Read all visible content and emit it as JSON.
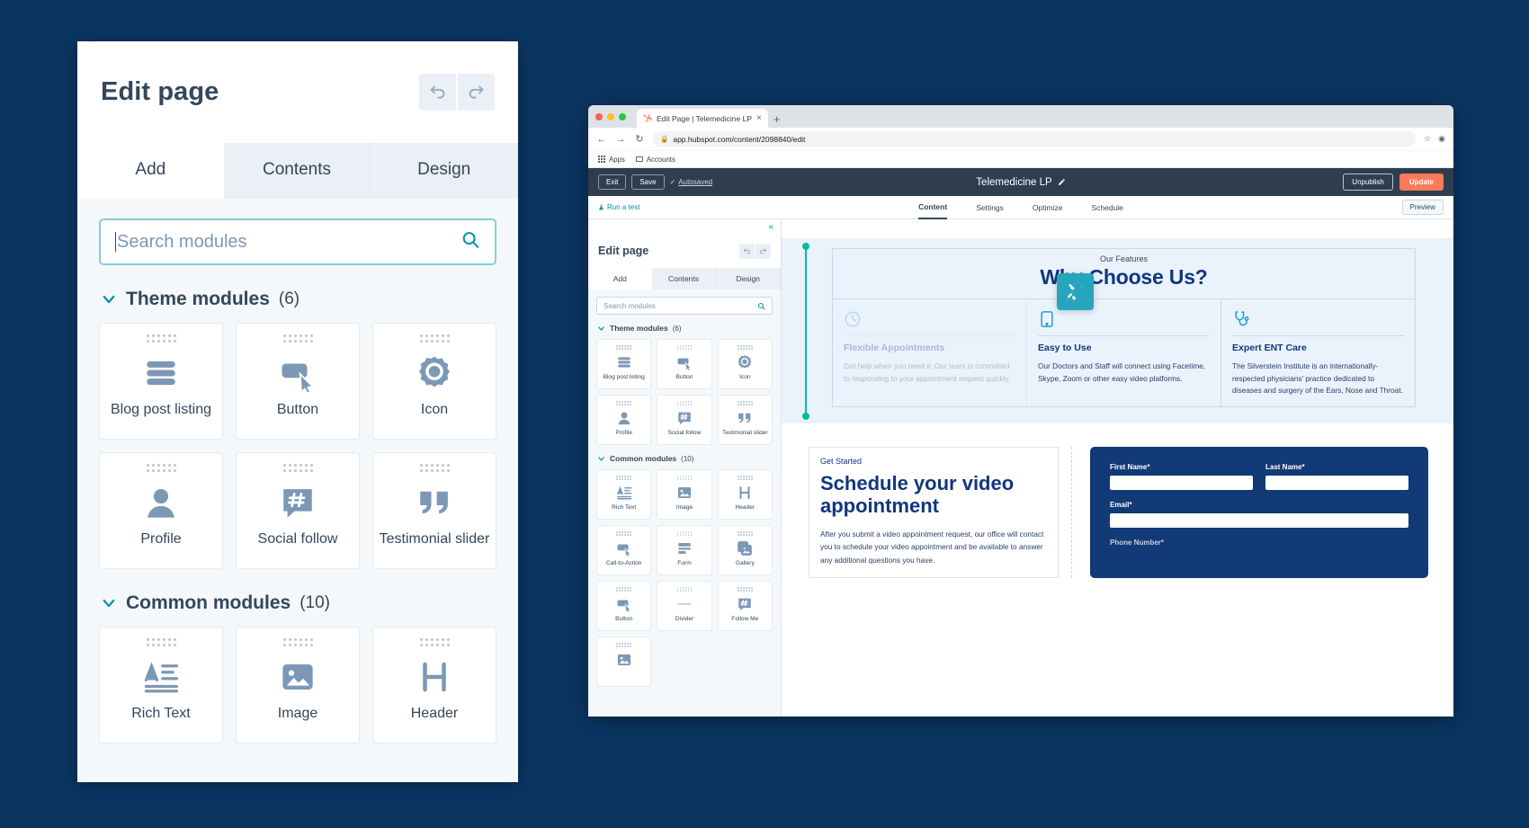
{
  "page": {
    "bg_color": "#0b3461"
  },
  "editor_panel": {
    "title": "Edit page",
    "undo_label": "Undo",
    "redo_label": "Redo",
    "tabs": [
      {
        "label": "Add",
        "active": true
      },
      {
        "label": "Contents",
        "active": false
      },
      {
        "label": "Design",
        "active": false
      }
    ],
    "search": {
      "placeholder": "Search modules",
      "value": "",
      "icon": "search-icon"
    },
    "groups": [
      {
        "name": "Theme modules",
        "count": "(6)",
        "modules": [
          {
            "label": "Blog post listing",
            "icon": "list-lines-icon"
          },
          {
            "label": "Button",
            "icon": "button-cursor-icon"
          },
          {
            "label": "Icon",
            "icon": "badge-circle-icon"
          },
          {
            "label": "Profile",
            "icon": "person-icon"
          },
          {
            "label": "Social follow",
            "icon": "hashtag-bubble-icon"
          },
          {
            "label": "Testimonial slider",
            "icon": "quote-marks-icon"
          }
        ]
      },
      {
        "name": "Common modules",
        "count": "(10)",
        "modules": [
          {
            "label": "Rich Text",
            "icon": "rich-text-icon"
          },
          {
            "label": "Image",
            "icon": "image-icon"
          },
          {
            "label": "Header",
            "icon": "heading-h-icon"
          }
        ]
      }
    ]
  },
  "browser": {
    "tab": {
      "title": "Edit Page | Telemedicine LP",
      "close_label": "×",
      "favicon": "hubspot-sprocket-icon"
    },
    "new_tab_label": "+",
    "nav": {
      "back": "←",
      "forward": "→",
      "reload": "↻"
    },
    "url": "app.hubspot.com/content/2098840/edit",
    "lock_icon": "lock-icon",
    "star_icon": "star-icon",
    "profile_icon": "account-circle-icon",
    "bookmarks": [
      {
        "label": "Apps",
        "icon": "apps-grid-icon"
      },
      {
        "label": "Accounts",
        "icon": "folder-icon"
      }
    ]
  },
  "hubspot": {
    "toolbar": {
      "exit_label": "Exit",
      "save_label": "Save",
      "autosaved_label": "Autosaved",
      "autosaved_check": "✓",
      "doc_title": "Telemedicine LP",
      "edit_icon": "pencil-icon",
      "unpublish_label": "Unpublish",
      "update_label": "Update",
      "update_color": "#ff7a59"
    },
    "navbar": {
      "run_test_label": "Run a test",
      "run_test_icon": "flask-icon",
      "tabs": [
        {
          "label": "Content",
          "active": true
        },
        {
          "label": "Settings",
          "active": false
        },
        {
          "label": "Optimize",
          "active": false
        },
        {
          "label": "Schedule",
          "active": false
        }
      ],
      "preview_label": "Preview"
    },
    "inner_editor": {
      "collapse_icon": "double-chevron-left-icon",
      "title": "Edit page",
      "tabs": [
        {
          "label": "Add",
          "active": true
        },
        {
          "label": "Contents",
          "active": false
        },
        {
          "label": "Design",
          "active": false
        }
      ],
      "search": {
        "placeholder": "Search modules",
        "value": "",
        "icon": "search-icon"
      },
      "groups": [
        {
          "name": "Theme modules",
          "count": "(6)",
          "modules": [
            {
              "label": "Blog post listing",
              "icon": "list-lines-icon"
            },
            {
              "label": "Button",
              "icon": "button-cursor-icon"
            },
            {
              "label": "Icon",
              "icon": "badge-circle-icon"
            },
            {
              "label": "Profile",
              "icon": "person-icon"
            },
            {
              "label": "Social follow",
              "icon": "hashtag-bubble-icon"
            },
            {
              "label": "Testimonial slider",
              "icon": "quote-marks-icon"
            }
          ]
        },
        {
          "name": "Common modules",
          "count": "(10)",
          "modules": [
            {
              "label": "Rich Text",
              "icon": "rich-text-icon"
            },
            {
              "label": "Image",
              "icon": "image-icon"
            },
            {
              "label": "Header",
              "icon": "heading-h-icon"
            },
            {
              "label": "Call-to-Action",
              "icon": "button-cursor-icon"
            },
            {
              "label": "Form",
              "icon": "form-rows-icon"
            },
            {
              "label": "Gallery",
              "icon": "gallery-icon"
            },
            {
              "label": "Button",
              "icon": "button-cursor-icon"
            },
            {
              "label": "Divider",
              "icon": "divider-line-icon"
            },
            {
              "label": "Follow Me",
              "icon": "hashtag-bubble-icon"
            },
            {
              "label": "",
              "icon": "image-icon"
            }
          ]
        }
      ]
    },
    "preview": {
      "drag_chip_icon": "tools-cross-icon",
      "drag_chip_color": "#27a5bd",
      "features": {
        "eyebrow": "Our Features",
        "heading": "Why Choose Us?",
        "columns": [
          {
            "icon": "clock-icon",
            "title": "Flexible Appointments",
            "body": "Get help when you need it. Our team is committed to responding to your appointment request quickly.",
            "dimmed": true
          },
          {
            "icon": "tablet-icon",
            "title": "Easy to Use",
            "body": "Our Doctors and Staff will connect using Facetime, Skype, Zoom or other easy video platforms.",
            "dimmed": false
          },
          {
            "icon": "stethoscope-icon",
            "title": "Expert ENT Care",
            "body": "The Silverstein Institute is an internationally-respected physicians' practice dedicated to diseases and surgery of the Ears, Nose and Throat.",
            "dimmed": false
          }
        ]
      },
      "schedule": {
        "eyebrow": "Get Started",
        "heading": "Schedule your video appointment",
        "body": "After you submit a video appointment request, our office will contact you to schedule your video appointment and be available to answer any additional questions you have.",
        "form": {
          "bg_color": "#123a76",
          "fields": [
            {
              "label": "First Name*",
              "value": ""
            },
            {
              "label": "Last Name*",
              "value": ""
            },
            {
              "label": "Email*",
              "value": ""
            },
            {
              "label": "Phone Number*",
              "value": ""
            }
          ]
        }
      }
    }
  }
}
